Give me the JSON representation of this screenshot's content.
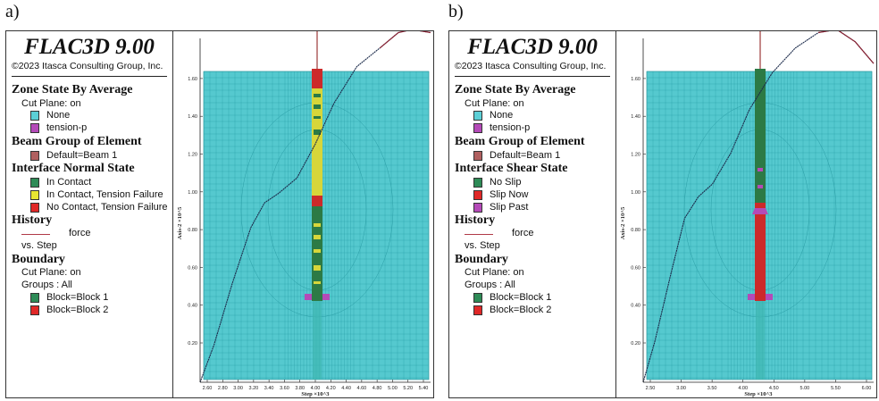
{
  "panel_labels": {
    "a": "a)",
    "b": "b)"
  },
  "panels": [
    {
      "id": "a",
      "app_title": "FLAC3D 9.00",
      "copyright": "©2023 Itasca Consulting Group, Inc.",
      "zone_state": {
        "title": "Zone State By Average",
        "cut_plane": "Cut Plane: on",
        "items": [
          {
            "label": "None",
            "color": "#5ccfd6"
          },
          {
            "label": "tension-p",
            "color": "#b44ab8"
          }
        ]
      },
      "beam_group": {
        "title": "Beam Group of Element",
        "items": [
          {
            "label": "Default=Beam 1",
            "color": "#b06060"
          }
        ]
      },
      "interface_state": {
        "title": "Interface Normal State",
        "items": [
          {
            "label": "In Contact",
            "color": "#2e8b57"
          },
          {
            "label": "In Contact, Tension Failure",
            "color": "#e8e632"
          },
          {
            "label": "No Contact, Tension Failure",
            "color": "#e02828"
          }
        ]
      },
      "history": {
        "title": "History",
        "force": "force",
        "vs": "vs. Step"
      },
      "boundary": {
        "title": "Boundary",
        "cut_plane": "Cut Plane: on",
        "groups": "Groups : All",
        "items": [
          {
            "label": "Block=Block 1",
            "color": "#2e8b57"
          },
          {
            "label": "Block=Block 2",
            "color": "#e02828"
          }
        ]
      },
      "axis": {
        "y_title": "Axis-2 ×10^5",
        "x_title": "Step ×10^3",
        "y_ticks": [
          "0.20",
          "0.40",
          "0.60",
          "0.80",
          "1.00",
          "1.20",
          "1.40",
          "1.60"
        ],
        "x_ticks": [
          "2.60",
          "2.80",
          "3.00",
          "3.20",
          "3.40",
          "3.60",
          "3.80",
          "4.00",
          "4.20",
          "4.40",
          "4.60",
          "4.80",
          "5.00",
          "5.20",
          "5.40"
        ]
      },
      "pile_pattern": "mixed"
    },
    {
      "id": "b",
      "app_title": "FLAC3D 9.00",
      "copyright": "©2023 Itasca Consulting Group, Inc.",
      "zone_state": {
        "title": "Zone State By Average",
        "cut_plane": "Cut Plane: on",
        "items": [
          {
            "label": "None",
            "color": "#5ccfd6"
          },
          {
            "label": "tension-p",
            "color": "#b44ab8"
          }
        ]
      },
      "beam_group": {
        "title": "Beam Group of Element",
        "items": [
          {
            "label": "Default=Beam 1",
            "color": "#b06060"
          }
        ]
      },
      "interface_state": {
        "title": "Interface Shear State",
        "items": [
          {
            "label": "No Slip",
            "color": "#2e8b57"
          },
          {
            "label": "Slip Now",
            "color": "#e02828"
          },
          {
            "label": "Slip Past",
            "color": "#b44ab8"
          }
        ]
      },
      "history": {
        "title": "History",
        "force": "force",
        "vs": "vs. Step"
      },
      "boundary": {
        "title": "Boundary",
        "cut_plane": "Cut Plane: on",
        "groups": "Groups : All",
        "items": [
          {
            "label": "Block=Block 1",
            "color": "#2e8b57"
          },
          {
            "label": "Block=Block 2",
            "color": "#e02828"
          }
        ]
      },
      "axis": {
        "y_title": "Axis-2 ×10^5",
        "x_title": "Step ×10^3",
        "y_ticks": [
          "0.20",
          "0.40",
          "0.60",
          "0.80",
          "1.00",
          "1.20",
          "1.40",
          "1.60"
        ],
        "x_ticks": [
          "2.50",
          "3.00",
          "3.50",
          "4.00",
          "4.50",
          "5.00",
          "5.50",
          "6.00"
        ]
      },
      "pile_pattern": "split"
    }
  ]
}
